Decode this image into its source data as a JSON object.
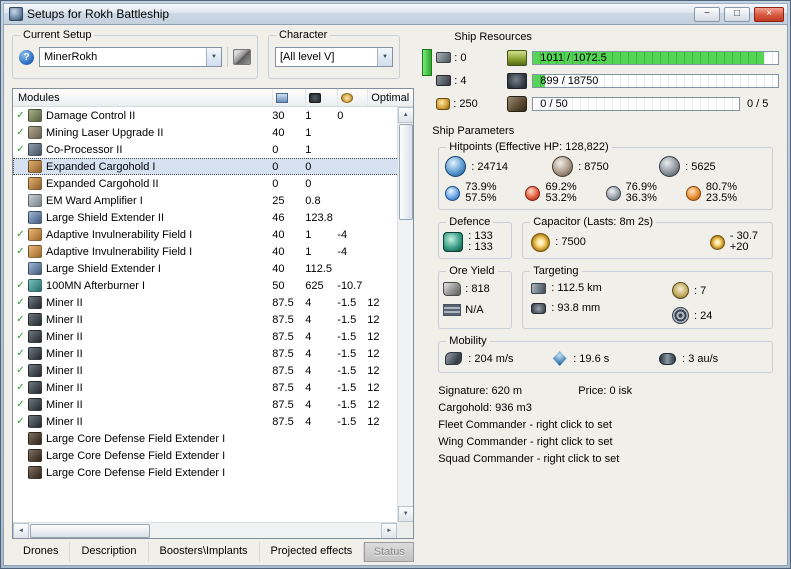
{
  "window": {
    "title": "Setups for Rokh Battleship",
    "controls": {
      "minimize": "−",
      "maximize": "□",
      "close": "×"
    }
  },
  "glyphs": {
    "check": "✓",
    "dropdown_arrow": "▼",
    "scroll_up": "▲",
    "scroll_down": "▼",
    "scroll_left": "◄",
    "scroll_right": "►",
    "help": "?"
  },
  "setup": {
    "label": "Current Setup",
    "value": "MinerRokh"
  },
  "character": {
    "label": "Character",
    "value": "[All level V]"
  },
  "modules": {
    "header": "Modules",
    "optimal_header": "Optimal",
    "rows": [
      {
        "check": true,
        "icon": "damage-control",
        "name": "Damage Control II",
        "cpu": "30",
        "pg": "1",
        "cap": "0",
        "opt": ""
      },
      {
        "check": true,
        "icon": "mining-laser-upgrade",
        "name": "Mining Laser Upgrade II",
        "cpu": "40",
        "pg": "1",
        "cap": "",
        "opt": ""
      },
      {
        "check": true,
        "icon": "co-processor",
        "name": "Co-Processor II",
        "cpu": "0",
        "pg": "1",
        "cap": "",
        "opt": ""
      },
      {
        "check": false,
        "icon": "expanded-cargohold",
        "name": "Expanded Cargohold I",
        "cpu": "0",
        "pg": "0",
        "cap": "",
        "opt": "",
        "selected": true
      },
      {
        "check": false,
        "icon": "expanded-cargohold",
        "name": "Expanded Cargohold II",
        "cpu": "0",
        "pg": "0",
        "cap": "",
        "opt": ""
      },
      {
        "check": false,
        "icon": "em-ward-amplifier",
        "name": "EM Ward Amplifier I",
        "cpu": "25",
        "pg": "0.8",
        "cap": "",
        "opt": ""
      },
      {
        "check": false,
        "icon": "shield-extender",
        "name": "Large Shield Extender II",
        "cpu": "46",
        "pg": "123.8",
        "cap": "",
        "opt": ""
      },
      {
        "check": true,
        "icon": "invulnerability-field",
        "name": "Adaptive Invulnerability Field I",
        "cpu": "40",
        "pg": "1",
        "cap": "-4",
        "opt": ""
      },
      {
        "check": true,
        "icon": "invulnerability-field",
        "name": "Adaptive Invulnerability Field I",
        "cpu": "40",
        "pg": "1",
        "cap": "-4",
        "opt": ""
      },
      {
        "check": false,
        "icon": "shield-extender",
        "name": "Large Shield Extender I",
        "cpu": "40",
        "pg": "112.5",
        "cap": "",
        "opt": ""
      },
      {
        "check": true,
        "icon": "afterburner",
        "name": "100MN Afterburner I",
        "cpu": "50",
        "pg": "625",
        "cap": "-10.7",
        "opt": ""
      },
      {
        "check": true,
        "icon": "miner",
        "name": "Miner II",
        "cpu": "87.5",
        "pg": "4",
        "cap": "-1.5",
        "opt": "12"
      },
      {
        "check": true,
        "icon": "miner",
        "name": "Miner II",
        "cpu": "87.5",
        "pg": "4",
        "cap": "-1.5",
        "opt": "12"
      },
      {
        "check": true,
        "icon": "miner",
        "name": "Miner II",
        "cpu": "87.5",
        "pg": "4",
        "cap": "-1.5",
        "opt": "12"
      },
      {
        "check": true,
        "icon": "miner",
        "name": "Miner II",
        "cpu": "87.5",
        "pg": "4",
        "cap": "-1.5",
        "opt": "12"
      },
      {
        "check": true,
        "icon": "miner",
        "name": "Miner II",
        "cpu": "87.5",
        "pg": "4",
        "cap": "-1.5",
        "opt": "12"
      },
      {
        "check": true,
        "icon": "miner",
        "name": "Miner II",
        "cpu": "87.5",
        "pg": "4",
        "cap": "-1.5",
        "opt": "12"
      },
      {
        "check": true,
        "icon": "miner",
        "name": "Miner II",
        "cpu": "87.5",
        "pg": "4",
        "cap": "-1.5",
        "opt": "12"
      },
      {
        "check": true,
        "icon": "miner",
        "name": "Miner II",
        "cpu": "87.5",
        "pg": "4",
        "cap": "-1.5",
        "opt": "12"
      },
      {
        "check": false,
        "icon": "rig-extender",
        "name": "Large Core Defense Field Extender I",
        "cpu": "",
        "pg": "",
        "cap": "",
        "opt": ""
      },
      {
        "check": false,
        "icon": "rig-extender",
        "name": "Large Core Defense Field Extender I",
        "cpu": "",
        "pg": "",
        "cap": "",
        "opt": ""
      },
      {
        "check": false,
        "icon": "rig-extender",
        "name": "Large Core Defense Field Extender I",
        "cpu": "",
        "pg": "",
        "cap": "",
        "opt": ""
      }
    ]
  },
  "resources": {
    "title": "Ship Resources",
    "turrets_count": ": 0",
    "launchers_count": ": 4",
    "calibration_count": ": 250",
    "cpu_bar": {
      "text": "1011 / 1072.5",
      "pct": 94.3
    },
    "powergrid_bar": {
      "text": "899 / 18750",
      "pct": 4.8
    },
    "calibration_bar": {
      "text": "0 / 50",
      "pct": 0
    },
    "rig_slots": "0 / 5"
  },
  "parameters": {
    "title": "Ship Parameters",
    "hitpoints": {
      "label": "Hitpoints (Effective HP: 128,822)",
      "shield": ": 24714",
      "armor": ": 8750",
      "structure": ": 5625",
      "resists": [
        {
          "shield": "73.9%",
          "armor": "57.5%"
        },
        {
          "shield": "69.2%",
          "armor": "53.2%"
        },
        {
          "shield": "76.9%",
          "armor": "36.3%"
        },
        {
          "shield": "80.7%",
          "armor": "23.5%"
        }
      ]
    },
    "defence": {
      "label": "Defence",
      "line1": ": 133",
      "line2": ": 133"
    },
    "capacitor": {
      "label": "Capacitor (Lasts: 8m 2s)",
      "amount": ": 7500",
      "drain": "- 30.7",
      "recharge": "+20"
    },
    "ore_yield": {
      "label": "Ore Yield",
      "amount": ": 818",
      "ice": "N/A"
    },
    "targeting": {
      "label": "Targeting",
      "range": ": 112.5 km",
      "resolution": ": 93.8 mm",
      "max_targets": ": 7",
      "scan_strength": ": 24"
    },
    "mobility": {
      "label": "Mobility",
      "speed": ": 204 m/s",
      "align_time": ": 19.6 s",
      "warp_speed": ": 3 au/s"
    },
    "signature": "Signature: 620 m",
    "price": "Price: 0 isk",
    "cargohold": "Cargohold: 936 m3",
    "fleet_commander": "Fleet Commander - right click to set",
    "wing_commander": "Wing Commander - right click to set",
    "squad_commander": "Squad Commander - right click to set"
  },
  "tabs": [
    {
      "label": "Drones"
    },
    {
      "label": "Description"
    },
    {
      "label": "Boosters\\Implants"
    },
    {
      "label": "Projected effects"
    }
  ],
  "status_button": "Status",
  "colors": {
    "bar_fill": "#46c846",
    "check": "#2f9e2f",
    "selected_row": "#d6e2f2",
    "close_button": "#d14836"
  }
}
